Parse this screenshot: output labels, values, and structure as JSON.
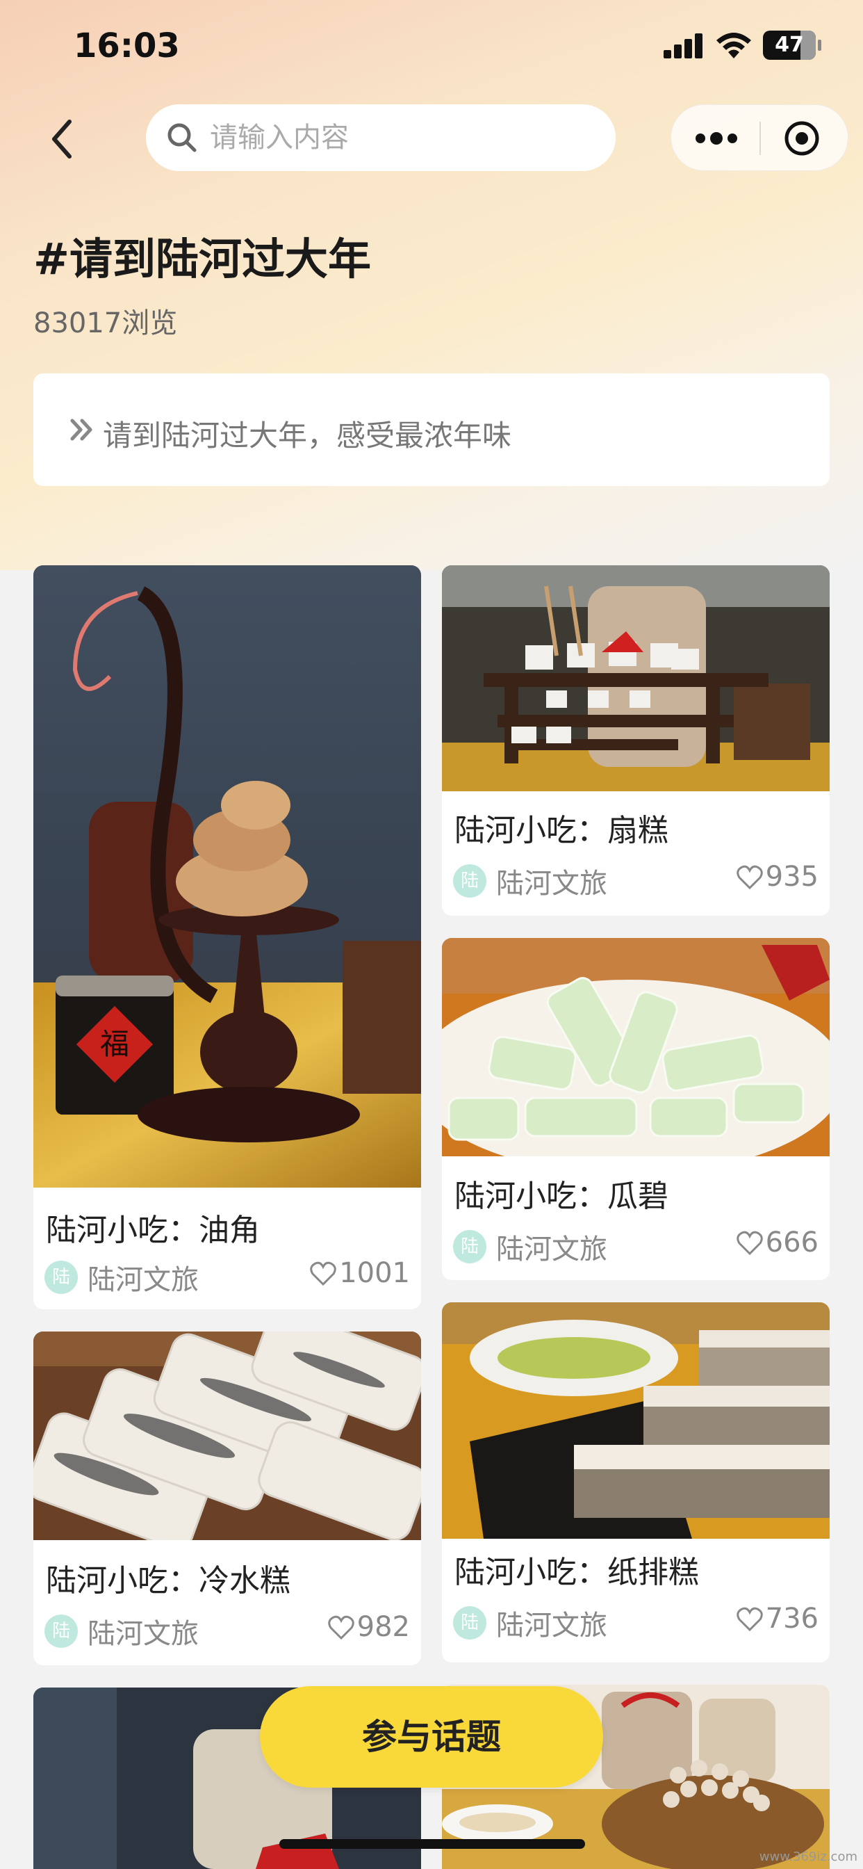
{
  "status_bar": {
    "time": "16:03",
    "battery": "47"
  },
  "search": {
    "placeholder": "请输入内容"
  },
  "topic": {
    "title": "#请到陆河过大年",
    "views_count": "83017",
    "views_suffix": "浏览",
    "description": "请到陆河过大年，感受最浓年味"
  },
  "cards": [
    {
      "title": "陆河小吃：油角",
      "author": "陆河文旅",
      "avatar_char": "陆",
      "likes": "1001"
    },
    {
      "title": "陆河小吃：扇糕",
      "author": "陆河文旅",
      "avatar_char": "陆",
      "likes": "935"
    },
    {
      "title": "陆河小吃：瓜碧",
      "author": "陆河文旅",
      "avatar_char": "陆",
      "likes": "666"
    },
    {
      "title": "陆河小吃：冷水糕",
      "author": "陆河文旅",
      "avatar_char": "陆",
      "likes": "982"
    },
    {
      "title": "陆河小吃：纸排糕",
      "author": "陆河文旅",
      "avatar_char": "陆",
      "likes": "736"
    }
  ],
  "fab": {
    "label": "参与话题"
  },
  "watermark": "www.369iz.com",
  "colors": {
    "accent": "#f9d939",
    "avatar_bg": "#bfe8df"
  }
}
